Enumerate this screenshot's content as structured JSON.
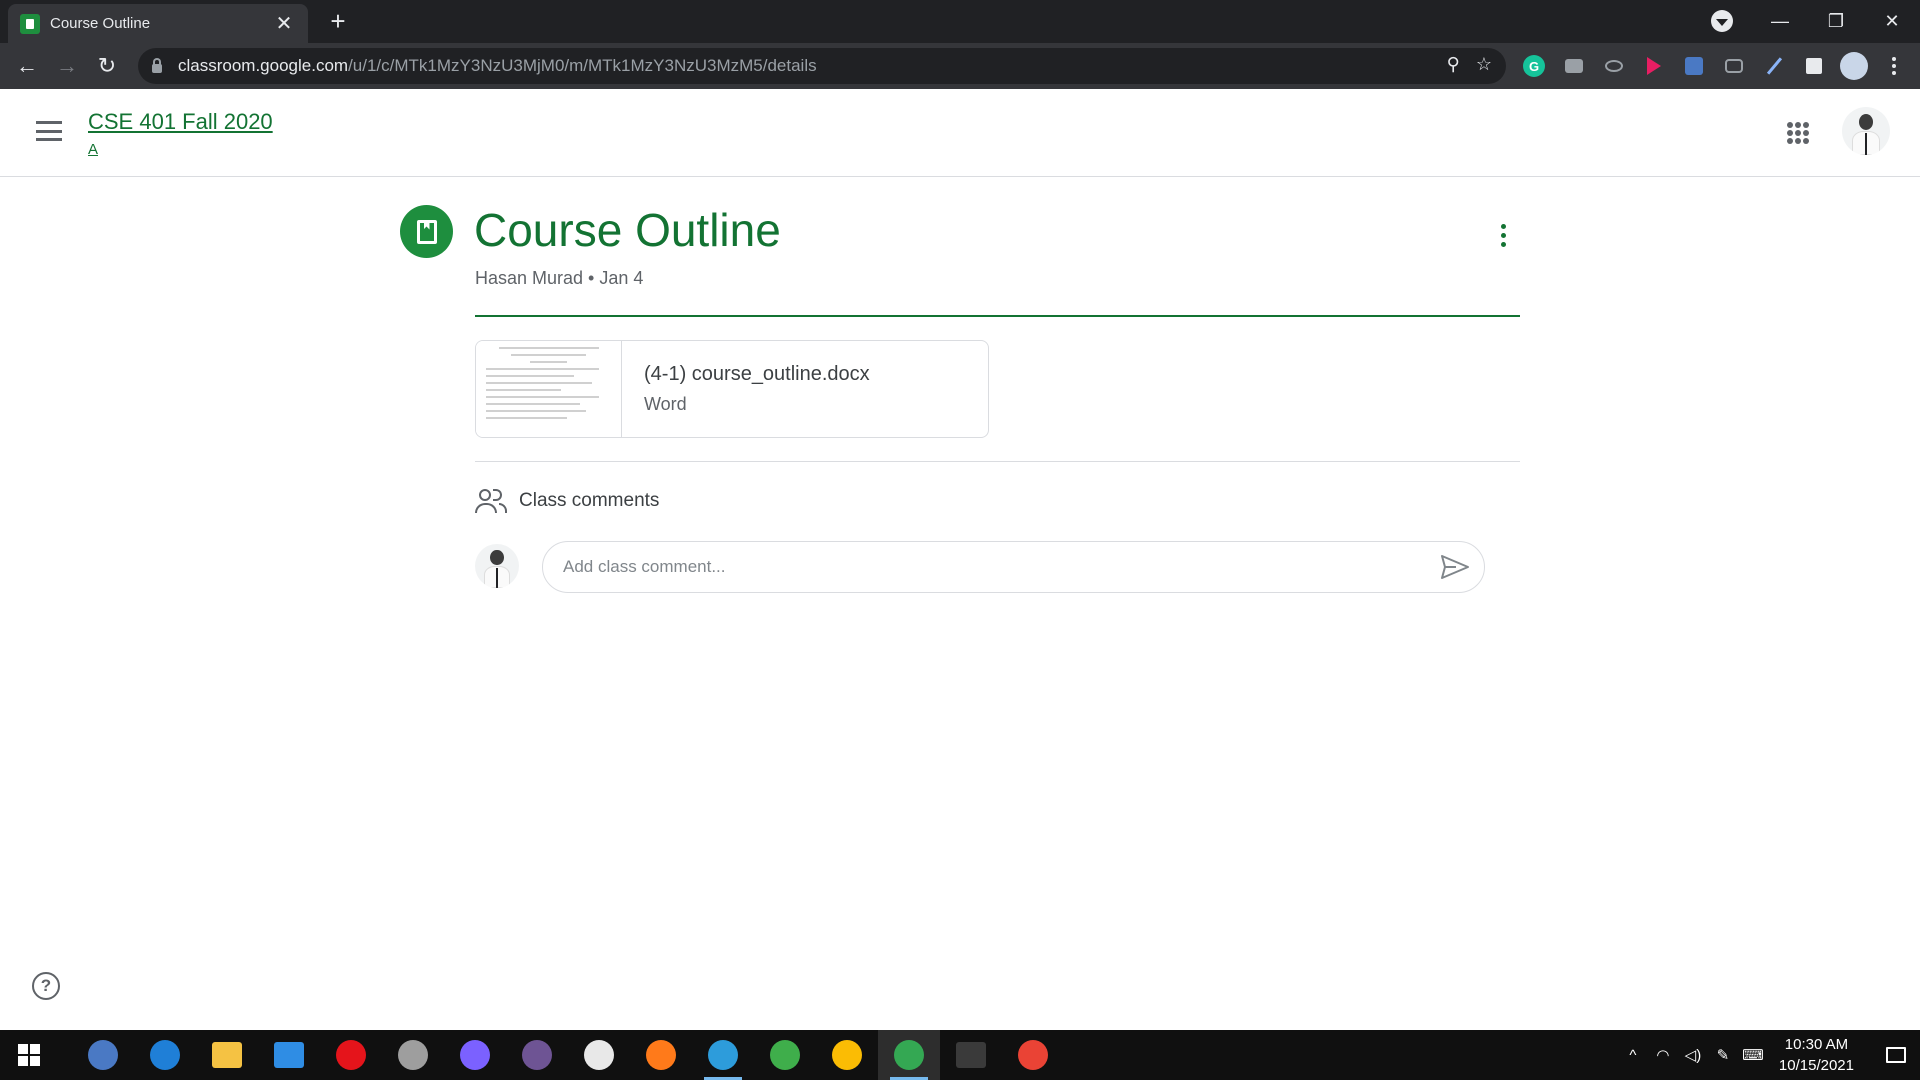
{
  "browser": {
    "tab_title": "Course Outline",
    "tab_close": "✕",
    "new_tab": "+",
    "url_host": "classroom.google.com",
    "url_path": "/u/1/c/MTk1MzY3NzU3MjM0/m/MTk1MzY3NzU3MzM5/details",
    "win_minimize": "—",
    "win_restore": "❐",
    "win_close": "✕",
    "back": "←",
    "forward": "→",
    "reload": "↻",
    "zoom_icon": "⚲",
    "star_icon": "☆",
    "ext_grammarly": "G"
  },
  "header": {
    "class_title": "CSE 401 Fall 2020",
    "class_section": "A"
  },
  "post": {
    "title": "Course Outline",
    "meta": "Hasan Murad • Jan 4",
    "attachment": {
      "name": "(4-1) course_outline.docx",
      "type": "Word"
    }
  },
  "comments": {
    "title": "Class comments",
    "placeholder": "Add class comment..."
  },
  "help": {
    "label": "?"
  },
  "taskbar": {
    "time": "10:30 AM",
    "date": "10/15/2021",
    "apps": [
      {
        "name": "qbittorrent",
        "color": "#4a79c4"
      },
      {
        "name": "edge",
        "color": "#1f7fd7"
      },
      {
        "name": "file-explorer",
        "color": "#f5c243"
      },
      {
        "name": "mail",
        "color": "#2f8de4"
      },
      {
        "name": "opera",
        "color": "#e5141b"
      },
      {
        "name": "satellite",
        "color": "#9e9e9e"
      },
      {
        "name": "messenger",
        "color": "#7b61ff"
      },
      {
        "name": "github",
        "color": "#6e5494"
      },
      {
        "name": "paint",
        "color": "#e8e8e8"
      },
      {
        "name": "firefox",
        "color": "#ff7a1a"
      },
      {
        "name": "vscode",
        "color": "#2d9cdb"
      },
      {
        "name": "pinwheel",
        "color": "#3fae4b"
      },
      {
        "name": "chrome-1",
        "color": "#fbbc04"
      },
      {
        "name": "chrome-2",
        "color": "#34a853"
      },
      {
        "name": "terminal",
        "color": "#3a3a3a"
      },
      {
        "name": "chrome-3",
        "color": "#ea4335"
      }
    ]
  }
}
